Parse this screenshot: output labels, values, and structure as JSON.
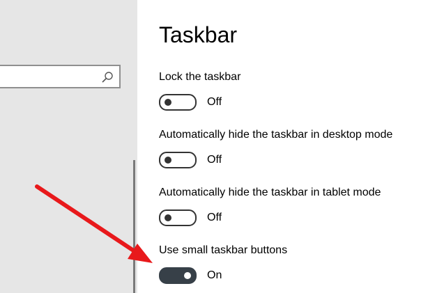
{
  "title": "Taskbar",
  "search": {
    "placeholder": ""
  },
  "settings": [
    {
      "label": "Lock the taskbar",
      "state": "Off",
      "on": false
    },
    {
      "label": "Automatically hide the taskbar in desktop mode",
      "state": "Off",
      "on": false
    },
    {
      "label": "Automatically hide the taskbar in tablet mode",
      "state": "Off",
      "on": false
    },
    {
      "label": "Use small taskbar buttons",
      "state": "On",
      "on": true
    }
  ],
  "colors": {
    "sidebar_bg": "#e6e6e6",
    "toggle_on": "#374048",
    "annotation_arrow": "#e8191b"
  },
  "icons": {
    "search": "search-icon"
  }
}
